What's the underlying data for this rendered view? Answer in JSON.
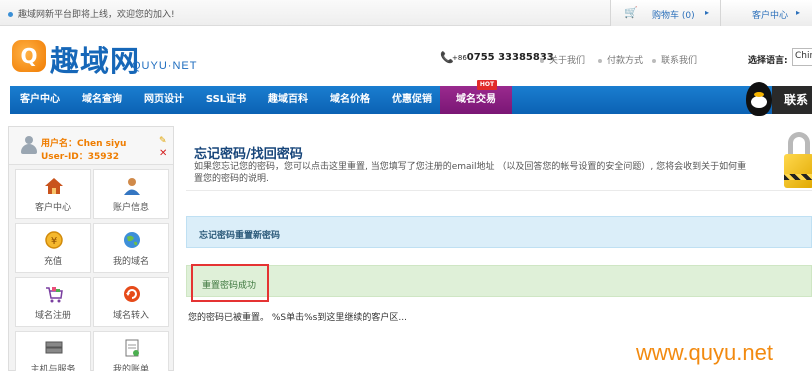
{
  "topbar": {
    "notice": "趣域网新平台即将上线，欢迎您的加入!",
    "cart_label": "购物车 (0)",
    "member_label": "客户中心"
  },
  "header": {
    "logo_text": "趣域网",
    "logo_sub": "QUYU·NET",
    "phone_prefix": "+86",
    "phone_number": "0755 33385833",
    "links": [
      "关于我们",
      "付款方式",
      "联系我们"
    ],
    "lang_label": "选择语言:",
    "lang_value": "Chin"
  },
  "nav": {
    "items": [
      "客户中心",
      "域名查询",
      "网页设计",
      "SSL证书",
      "趣域百科",
      "域名价格",
      "优惠促销",
      "域名交易"
    ],
    "hot_badge": "HOT",
    "contact": "联系"
  },
  "sidebar": {
    "user_name": "用户名：Chen siyu",
    "user_id": "User-ID：35932",
    "tiles": [
      "客户中心",
      "账户信息",
      "充值",
      "我的域名",
      "域名注册",
      "域名转入",
      "主机与服务",
      "我的账单"
    ]
  },
  "main": {
    "title": "忘记密码/找回密码",
    "desc": "如果您忘记您的密码，您可以点击这里重置, 当您填写了您注册的email地址 （以及回答您的帐号设置的安全问题）, 您将会收到关于如何重置您的密码的说明.",
    "info": "忘记密码重置新密码",
    "success": "重置密码成功",
    "message": "您的密码已被重置。 %S单击%s到这里继续的客户区..."
  },
  "watermark": "www.quyu.net",
  "colors": {
    "nav_blue": "#0b62b4",
    "nav_active": "#7a1675",
    "brand_orange": "#ef7d00",
    "success_bg": "#dff0d8",
    "info_bg": "#dbeef9",
    "highlight_red": "#e53333"
  }
}
